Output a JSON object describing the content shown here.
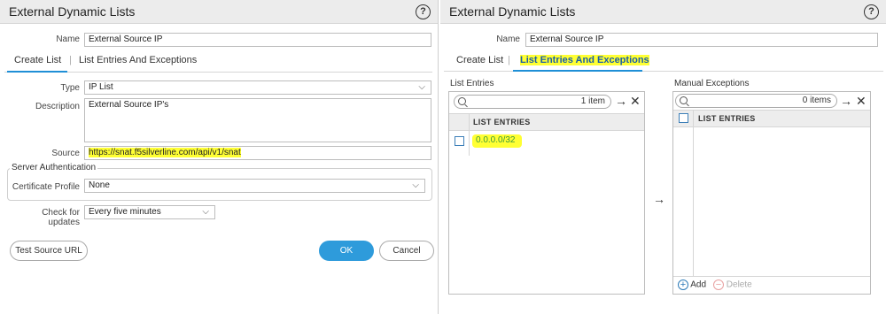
{
  "left": {
    "title": "External Dynamic Lists",
    "name_label": "Name",
    "name_value": "External Source IP",
    "tabs": [
      "Create List",
      "List Entries And Exceptions"
    ],
    "type_label": "Type",
    "type_value": "IP List",
    "description_label": "Description",
    "description_value": "External Source IP's",
    "source_label": "Source",
    "source_value": "https://snat.f5silverline.com/api/v1/snat",
    "server_auth_title": "Server Authentication",
    "cert_profile_label": "Certificate Profile",
    "cert_profile_value": "None",
    "check_updates_label": "Check for updates",
    "check_updates_value": "Every five minutes",
    "test_source_button": "Test Source URL",
    "ok_button": "OK",
    "cancel_button": "Cancel"
  },
  "right": {
    "title": "External Dynamic Lists",
    "name_label": "Name",
    "name_value": "External Source IP",
    "tabs": [
      "Create List",
      "List Entries And Exceptions"
    ],
    "list_entries": {
      "title": "List Entries",
      "count": "1 item",
      "column": "LIST ENTRIES",
      "rows": [
        "0.0.0.0/32"
      ]
    },
    "manual_exceptions": {
      "title": "Manual Exceptions",
      "count": "0 items",
      "column": "LIST ENTRIES",
      "add_label": "Add",
      "delete_label": "Delete"
    }
  },
  "colors": {
    "accent": "#2e9bdb",
    "highlight": "#ffff33",
    "entry_text": "#3a9a3a",
    "disabled": "#aaaaaa"
  },
  "icons": [
    "help-icon",
    "chevron-down-icon",
    "search-icon",
    "arrow-right-icon",
    "close-icon",
    "plus-circle-icon",
    "minus-circle-icon"
  ]
}
